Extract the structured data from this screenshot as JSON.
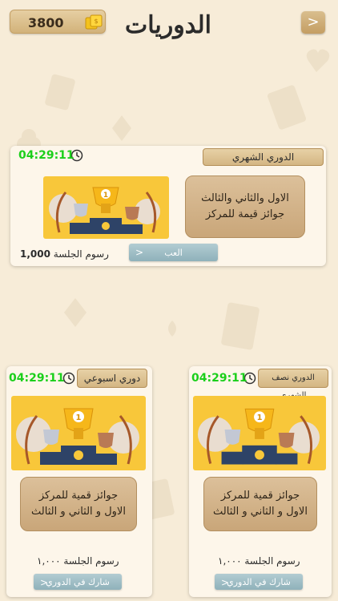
{
  "header": {
    "coins": "3800",
    "title": "الدوريات",
    "back_icon": "chevron-right-icon",
    "coin_icon": "coins-icon"
  },
  "tournaments": {
    "monthly": {
      "name": "الدوري الشهري",
      "timer": "04:29:11",
      "prize_line1": "الاول والثاني والثالث",
      "prize_line2": "جوائز قيمة للمركز",
      "fee_label": "رسوم الجلسة",
      "fee_value": "1,000",
      "button": "العب"
    },
    "weekly": {
      "name": "دوري اسبوعي",
      "timer": "04:29:11",
      "prize_line1": "جوائز قمية للمركز",
      "prize_line2": "الاول و الثاني و الثالث",
      "fee": "رسوم الجلسة ١,٠٠٠",
      "button": "شارك في الدوري"
    },
    "half_monthly": {
      "name": "الدوري نصف الشهري",
      "timer": "04:29:11",
      "prize_line1": "جوائز قمية للمركز",
      "prize_line2": "الاول و الثاني و الثالث",
      "fee": "رسوم الجلسة ١,٠٠٠",
      "button": "شارك في الدوري"
    }
  },
  "trophy": {
    "first": "1",
    "second": "2",
    "third": "3"
  },
  "colors": {
    "background": "#f7ecd8",
    "timer": "#1bcf1b",
    "trophy_bg": "#f8c73a",
    "button": "#9fbfc6"
  }
}
